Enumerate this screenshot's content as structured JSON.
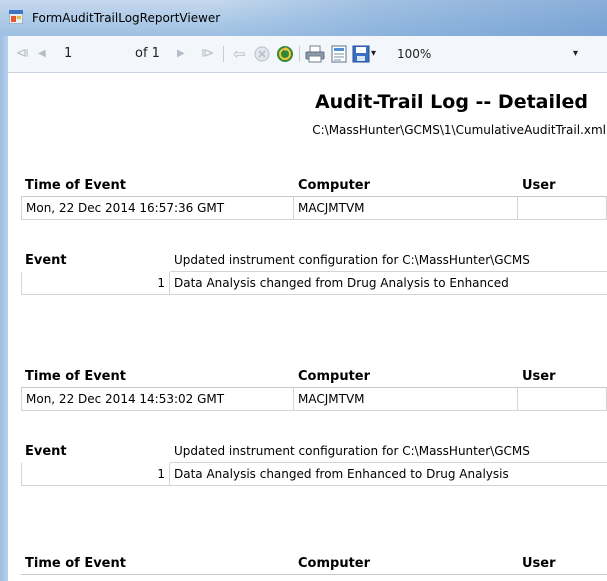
{
  "window": {
    "title": "FormAuditTrailLogReportViewer"
  },
  "toolbar": {
    "first_page": "⧏",
    "prev_page": "◀",
    "current_page": "1",
    "of_pages": "of 1",
    "next_page": "▶",
    "last_page": "⧐",
    "back": "⇦",
    "zoom": "100%",
    "zoom_dropdown": "▾",
    "save_dropdown": "▾"
  },
  "report": {
    "title": "Audit-Trail Log -- Detailed",
    "path": "C:\\MassHunter\\GCMS\\1\\CumulativeAuditTrail.xml",
    "headers": {
      "time": "Time of Event",
      "computer": "Computer",
      "user": "User",
      "event": "Event"
    },
    "entries": [
      {
        "time": "Mon, 22 Dec 2014 16:57:36 GMT",
        "computer": "MACJMTVM",
        "user": "",
        "event": "Updated instrument configuration for C:\\MassHunter\\GCMS",
        "detail_index": "1",
        "detail_text": "Data Analysis changed from Drug Analysis to Enhanced"
      },
      {
        "time": "Mon, 22 Dec 2014 14:53:02 GMT",
        "computer": "MACJMTVM",
        "user": "",
        "event": "Updated instrument configuration for C:\\MassHunter\\GCMS",
        "detail_index": "1",
        "detail_text": "Data Analysis changed from Enhanced to Drug Analysis"
      }
    ]
  }
}
